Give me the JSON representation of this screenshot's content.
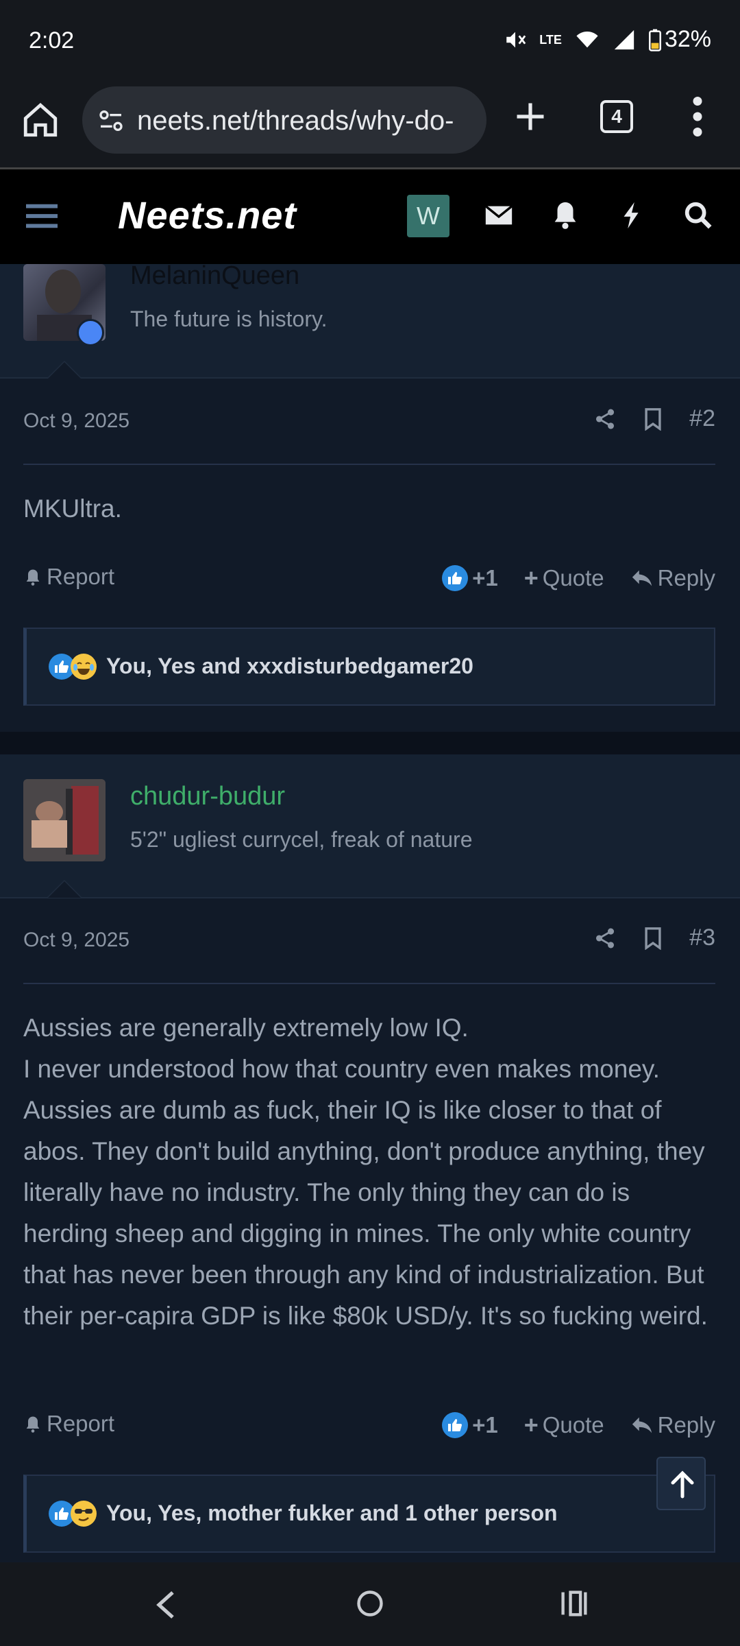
{
  "status_bar": {
    "time": "2:02",
    "battery": "32%",
    "network": "LTE"
  },
  "browser": {
    "url": "neets.net/threads/why-do-",
    "tab_count": "4"
  },
  "site": {
    "logo": "Neets.net",
    "user_initial": "W"
  },
  "posts": [
    {
      "username": "MelaninQueen",
      "user_title": "The future is history.",
      "date": "Oct 9, 2025",
      "number": "#2",
      "body": [
        "MKUltra."
      ],
      "report_label": "Report",
      "like_count": "+1",
      "quote_label": "Quote",
      "reply_label": "Reply",
      "reactions_text": "You, Yes and xxxdisturbedgamer20"
    },
    {
      "username": "chudur-budur",
      "user_title": "5'2\" ugliest currycel, freak of nature",
      "date": "Oct 9, 2025",
      "number": "#3",
      "body": [
        "Aussies are generally extremely low IQ.",
        "I never understood how that country even makes money. Aussies are dumb as fuck, their IQ is like closer to that of abos. They don't build anything, don't produce anything, they literally have no industry. The only thing they can do is herding sheep and digging in mines. The only white country that has never been through any kind of industrialization. But their per-capira GDP is like $80k USD/y. It's so fucking weird."
      ],
      "report_label": "Report",
      "like_count": "+1",
      "quote_label": "Quote",
      "reply_label": "Reply",
      "reactions_text": "You, Yes, mother fukker and 1 other person"
    }
  ],
  "colors": {
    "username_green": "#3fae6a",
    "like_blue": "#2a8be0",
    "accent_teal": "#36726b"
  }
}
